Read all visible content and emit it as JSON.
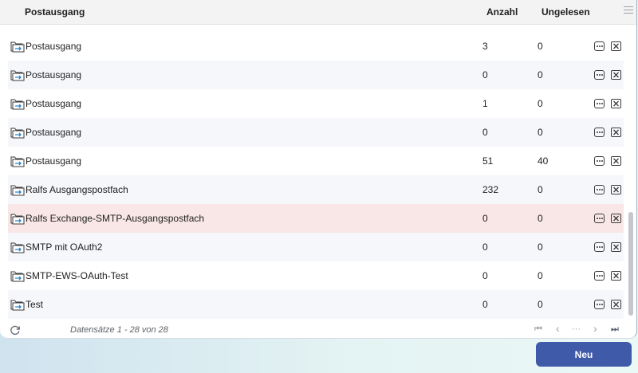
{
  "columns": {
    "name": "Postausgang",
    "count": "Anzahl",
    "unread": "Ungelesen"
  },
  "rows": [
    {
      "name": "Postausgang",
      "count": "3",
      "unread": "0"
    },
    {
      "name": "Postausgang",
      "count": "0",
      "unread": "0"
    },
    {
      "name": "Postausgang",
      "count": "1",
      "unread": "0"
    },
    {
      "name": "Postausgang",
      "count": "0",
      "unread": "0"
    },
    {
      "name": "Postausgang",
      "count": "51",
      "unread": "40"
    },
    {
      "name": "Ralfs Ausgangspostfach",
      "count": "232",
      "unread": "0"
    },
    {
      "name": "Ralfs Exchange-SMTP-Ausgangspostfach",
      "count": "0",
      "unread": "0"
    },
    {
      "name": "SMTP mit OAuth2",
      "count": "0",
      "unread": "0"
    },
    {
      "name": "SMTP-EWS-OAuth-Test",
      "count": "0",
      "unread": "0"
    },
    {
      "name": "Test",
      "count": "0",
      "unread": "0"
    }
  ],
  "selected_row_index": 6,
  "footer": {
    "records_text": "Datensätze 1 - 28 von 28",
    "pager": {
      "first": "⏮",
      "prev": "‹",
      "more": "···",
      "next": "›",
      "last": "⏭"
    }
  },
  "actions": {
    "new_label": "Neu"
  },
  "icons": {
    "row_folder": "folder-outbox-icon",
    "row_more": "more-icon",
    "row_delete": "delete-icon",
    "refresh": "refresh-icon",
    "column_menu": "column-menu-icon"
  },
  "colors": {
    "primary_button": "#3f5aa8",
    "selected_row": "#f8e7e6",
    "alt_row": "#f6f7fb",
    "folder_arrow": "#2b83c6"
  }
}
